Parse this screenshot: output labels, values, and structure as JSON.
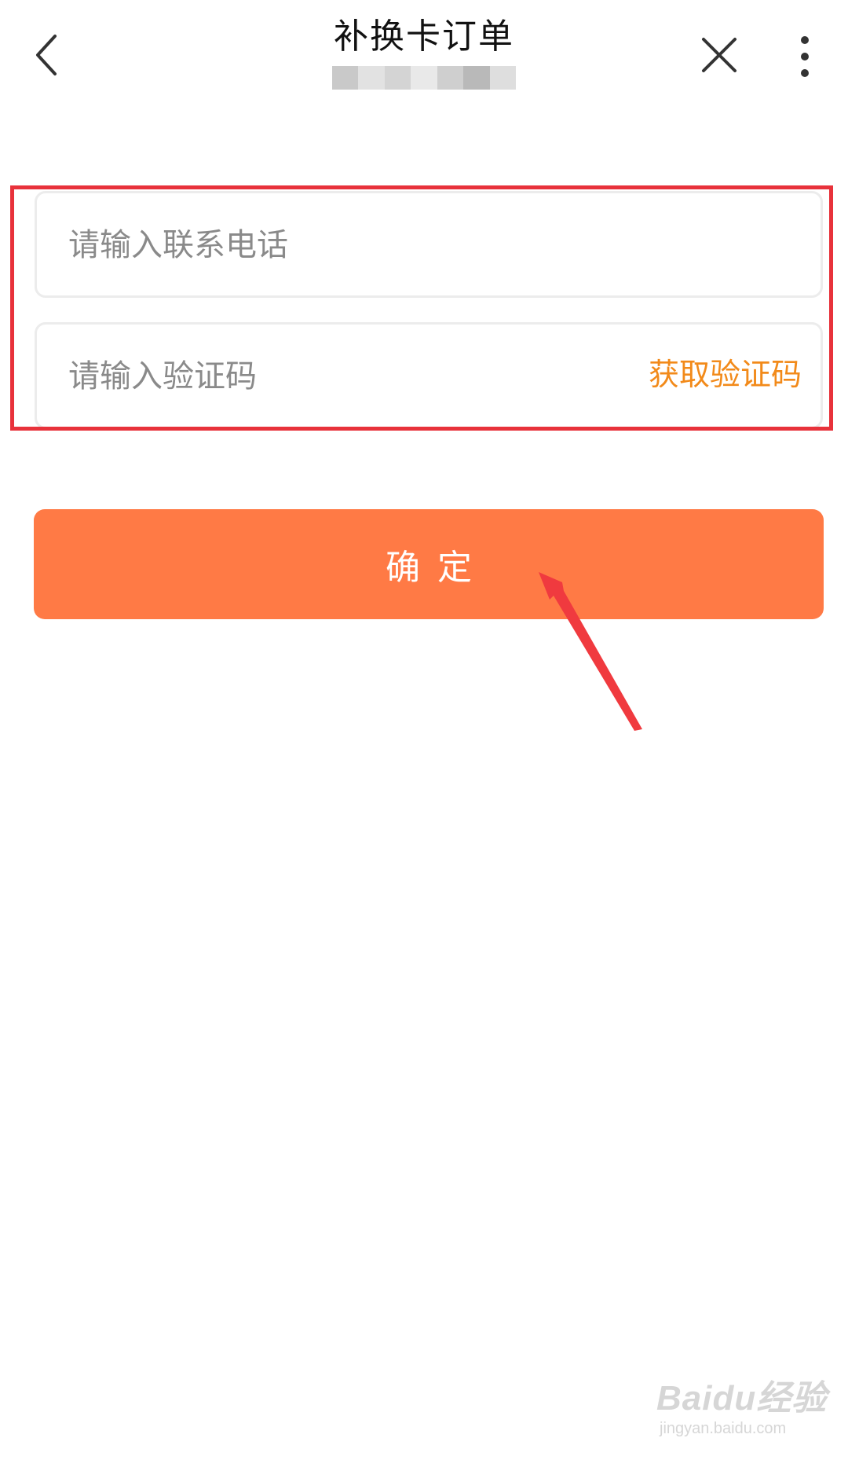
{
  "header": {
    "title": "补换卡订单",
    "back_icon": "chevron-left-icon",
    "close_icon": "close-icon",
    "more_icon": "more-vertical-icon"
  },
  "form": {
    "phone_placeholder": "请输入联系电话",
    "code_placeholder": "请输入验证码",
    "get_code_label": "获取验证码"
  },
  "confirm_label": "确定",
  "watermark": {
    "logo": "Baidu经验",
    "url": "jingyan.baidu.com"
  },
  "colors": {
    "accent": "#ff7a45",
    "link": "#f28a1a",
    "highlight": "#e8323b"
  }
}
